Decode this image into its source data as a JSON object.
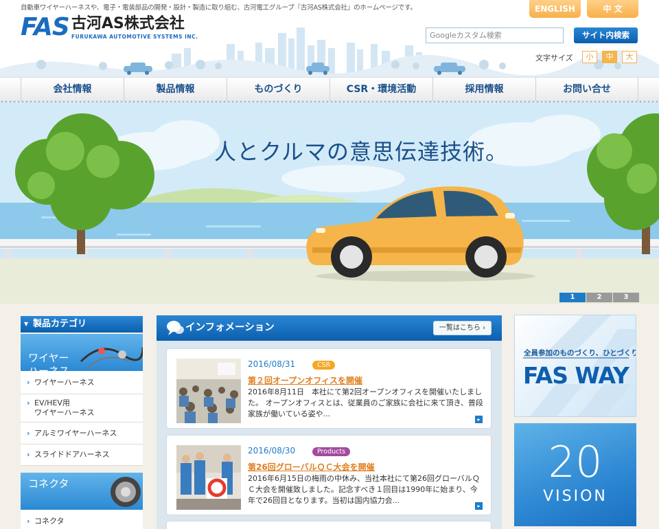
{
  "header": {
    "tagline": "自動車ワイヤーハーネスや、電子・電装部品の開発・設計・製造に取り組む、古河電工グループ『古河AS株式会社』のホームページです。",
    "logo_mark": "FAS",
    "logo_jp": "古河AS株式会社",
    "logo_en": "FURUKAWA AUTOMOTIVE SYSTEMS INC.",
    "lang_english": "ENGLISH",
    "lang_chinese": "中 文",
    "search_placeholder": "Googleカスタム検索",
    "search_button": "サイト内検索",
    "font_size_label": "文字サイズ",
    "font_sizes": [
      "小",
      "中",
      "大"
    ],
    "font_size_active": "中"
  },
  "nav": {
    "items": [
      "会社情報",
      "製品情報",
      "ものづくり",
      "CSR・環境活動",
      "採用情報",
      "お問い合せ"
    ]
  },
  "hero": {
    "caption": "人とクルマの意思伝達技術。",
    "slides": [
      "1",
      "2",
      "3"
    ],
    "active_slide": "1"
  },
  "sidebar": {
    "category_header": "製品カテゴリ",
    "wire_banner": "ワイヤー\nハーネス",
    "wire_items": [
      "ワイヤーハーネス",
      "EV/HEV用\nワイヤーハーネス",
      "アルミワイヤーハーネス",
      "スライドドアハーネス"
    ],
    "connector_banner": "コネクタ",
    "connector_items": [
      "コネクタ"
    ]
  },
  "info": {
    "title": "インフォメーション",
    "more_button": "一覧はこちら",
    "news": [
      {
        "date": "2016/08/31",
        "tag": "CSR",
        "tag_color": "#f5a623",
        "title": "第２回オープンオフィスを開催",
        "body": " 2016年8月11日　本社にて第2回オープンオフィスを開催いたしました。 オープンオフィスとは、従業員のご家族に会社に来て頂き、普段家族が働いている姿や..."
      },
      {
        "date": "2016/08/30",
        "tag": "Products",
        "tag_color": "#a44a9e",
        "title": "第26回グローバルＱＣ大会を開催",
        "body": "2016年6月15日の梅雨の中休み、当社本社にて第26回グローバルＱＣ大会を開催致しました。記念すべき１回目は1990年に始まり、今年で26回目となります。当初は国内協力会..."
      }
    ]
  },
  "right": {
    "fasway_sub": "全員参加のものづくり、ひとづくり",
    "fasway_main": "FAS WAY",
    "vision_num": "20",
    "vision_word": "VISION"
  },
  "colors": {
    "brand_blue": "#1a6cc0",
    "accent_orange": "#f5b54a",
    "nav_text": "#1a4f8a"
  }
}
